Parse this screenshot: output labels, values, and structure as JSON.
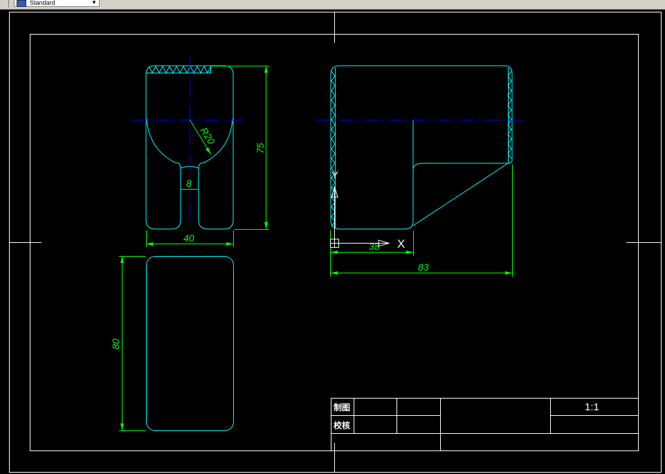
{
  "toolbar": {
    "text_style_value": "Standard"
  },
  "dimensions": {
    "radius": "R20",
    "width_top": "40",
    "slot_width": "8",
    "height_front": "75",
    "height_top": "80",
    "side_inner": "38",
    "side_total": "83"
  },
  "ucs": {
    "x_label": "X",
    "y_label": "Y"
  },
  "title_block": {
    "drawn_by_label": "制图",
    "checked_by_label": "校核",
    "scale": "1:1"
  },
  "colors": {
    "background": "#000000",
    "object_lines": "#00ffff",
    "dimensions": "#00ff00",
    "center_lines": "#0000ff",
    "frame": "#ffffff"
  }
}
